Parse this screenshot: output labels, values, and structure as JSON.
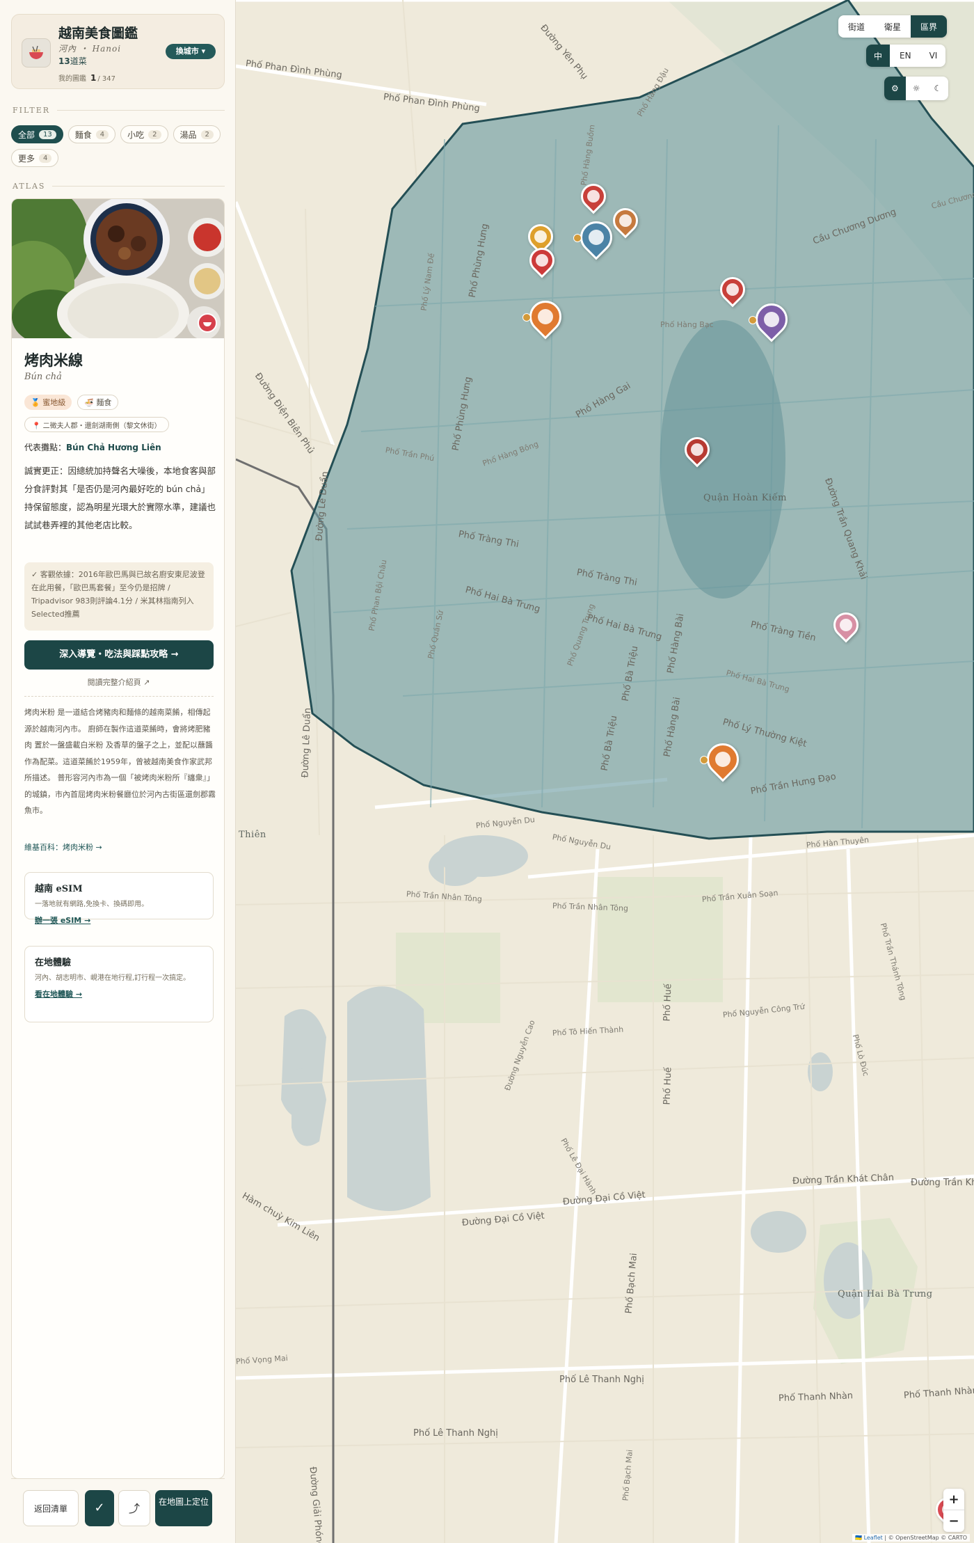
{
  "brand": {
    "title": "越南美食圖鑑",
    "city": "河內 ・ Hanoi",
    "count_num": "13",
    "count_label": "道菜",
    "progress_label": "我的圖鑑",
    "progress_done": "1",
    "progress_total": "/ 347",
    "switch_city": "換城市 ▾"
  },
  "filter": {
    "label": "FILTER",
    "chips": [
      {
        "label": "全部",
        "count": "13",
        "active": true
      },
      {
        "label": "麵食",
        "count": "4"
      },
      {
        "label": "小吃",
        "count": "2"
      },
      {
        "label": "湯品",
        "count": "2"
      },
      {
        "label": "更多",
        "count": "4"
      }
    ]
  },
  "atlas": {
    "label": "ATLAS"
  },
  "detail": {
    "name": "烤肉米線",
    "subname": "Bún chả",
    "tag_rank": "🏅 蜜地級",
    "tag_cat": "🍜 麵食",
    "location": "📍 二徵夫人郡・還劍湖南側（黎文休街）",
    "rep_label": "代表攤點：",
    "rep_value": "Bún Chả Hương Liên",
    "description": "誠實更正：因總統加持聲名大噪後，本地食客與部分食評對其「是否仍是河內最好吃的 bún chả」持保留態度，認為明星光環大於實際水準，建議也試試巷弄裡的其他老店比較。",
    "verify": "✓ 客觀依據：2016年歐巴馬與已故名廚安東尼波登在此用餐，「歐巴馬套餐」至今仍是招牌 / Tripadvisor 983則評論4.1分 / 米其林指南列入Selected推薦",
    "cta": "深入導覽・吃法與踩點攻略 →",
    "cta_link": "閱讀完整介紹頁 ↗",
    "intro": "烤肉米粉 是一道結合烤豬肉和麵條的越南菜餚，相傳起源於越南河內市。 廚師在製作這道菜餚時，會將烤肥豬肉 置於一盤盛載白米粉 及香草的盤子之上，並配以蘸醬作為配菜。這道菜餚於1959年，曾被越南美食作家武邦 所描述。 普形容河內市為一個「被烤肉米粉所『纏衆』」的城鎮，市內首屈烤肉米粉餐廳位於河內古街區還劍郡霧魚市。",
    "wiki": "維基百科：烤肉米粉 →"
  },
  "promos": [
    {
      "title": "越南 eSIM",
      "text": "一落地就有網路,免換卡、換碼即用。",
      "link": "辦一張 eSIM →"
    },
    {
      "title": "在地體驗",
      "text": "河內、胡志明市、峴港在地行程,訂行程一次搞定。",
      "link": "看在地體驗 →"
    }
  ],
  "bottom": {
    "back": "返回清單",
    "check": "✓",
    "share": "⤴",
    "map": "在地圖上定位"
  },
  "map_controls": {
    "layers": [
      "街道",
      "衛星",
      "區界"
    ],
    "active_layer": "區界",
    "langs": [
      "中",
      "EN",
      "VI"
    ],
    "active_lang": "中",
    "themes": [
      "⚙",
      "☼",
      "☾"
    ],
    "zoom_in": "+",
    "zoom_out": "−",
    "attribution_leaflet": "🇺🇦 Leaflet",
    "attribution_rest": " | © OpenStreetMap © CARTO"
  },
  "map_labels": {
    "district_main": "Quận Hoàn Kiếm",
    "district_south": "Quận Hai Bà Trưng",
    "thien": "Thiên",
    "streets": [
      "Phố Phan Đình Phùng",
      "Phố Phan Đình Phùng",
      "Đường Yên Phụ",
      "Phố Hàng Đậu",
      "Cầu Chương Dương",
      "Cầu Chương Dương",
      "Phố Phùng Hưng",
      "Phố Phùng Hưng",
      "Phố Lý Nam Đế",
      "Đường Lê Duẩn",
      "Đường Lê Duẩn",
      "Phố Trần Phú",
      "Đường Điện Biên Phủ",
      "Phố Tràng Thi",
      "Phố Tràng Thi",
      "Phố Hai Bà Trưng",
      "Phố Hai Bà Trưng",
      "Phố Tràng Tiền",
      "Phố Hai Bà Trưng",
      "Phố Lý Thường Kiệt",
      "Phố Trần Hưng Đạo",
      "Phố Hàn Thuyên",
      "Phố Nguyễn Du",
      "Phố Nguyễn Du",
      "Phố Trần Nhân Tông",
      "Phố Trần Nhân Tông",
      "Phố Trần Xuân Soạn",
      "Đường Trần Khát Chân",
      "Đường Trần Khát Chân",
      "Đường Đại Cồ Việt",
      "Đường Đại Cồ Việt",
      "Phố Lê Thanh Nghị",
      "Phố Lê Thanh Nghị",
      "Phố Thanh Nhàn",
      "Phố Thanh Nhàn",
      "Phố Huế",
      "Phố Huế",
      "Phố Bà Triệu",
      "Phố Bà Triệu",
      "Phố Hàng Bài",
      "Phố Hàng Bài",
      "Phố Quang Trung",
      "Phố Phan Bội Châu",
      "Phố Quán Sứ",
      "Đường Trần Quang Khải",
      "Phố Hàng Gai",
      "Phố Hàng Bông",
      "Hàm chuỳ Kim Liên",
      "Phố Nguyễn Công Trứ",
      "Phố Tô Hiến Thành",
      "Phố Bạch Mai",
      "Phố Bạch Mai",
      "Phố Vọng Mai",
      "Phố Lê Đại Hành",
      "Phố Hàng Buồm",
      "Đường Giải Phóng",
      "Phố Lò Đúc",
      "Đường Nguyễn Cao",
      "Phố Trần Thánh Tông",
      "Phố Hàng Bạc"
    ]
  }
}
